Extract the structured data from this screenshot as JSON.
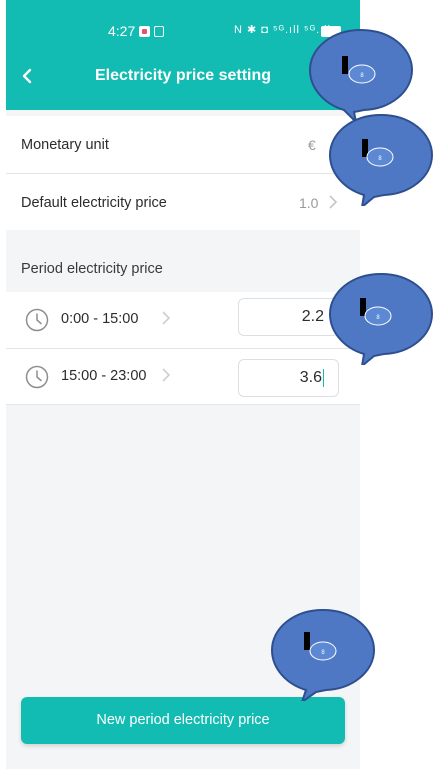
{
  "status_bar": {
    "time": "4:27",
    "right_icons": "N ✱ ◘ ⁵ᴳ.ıll ⁵ᴳ.ıll"
  },
  "header": {
    "title": "Electricity price setting",
    "back_icon": "chevron-left-icon"
  },
  "settings": {
    "monetary_unit": {
      "label": "Monetary unit",
      "value": "€"
    },
    "default_price": {
      "label": "Default electricity price",
      "value": "1.0"
    }
  },
  "periods": {
    "section_label": "Period electricity price",
    "items": [
      {
        "time": "0:00 - 15:00",
        "price": "2.2"
      },
      {
        "time": "15:00 - 23:00",
        "price": "3.6"
      }
    ]
  },
  "actions": {
    "new_period": "New period electricity price"
  },
  "overlay": {
    "bubble_label": "8"
  },
  "colors": {
    "accent": "#12bcb3",
    "bubble": "#4f78c4",
    "bubble_border": "#2e4f8f"
  }
}
